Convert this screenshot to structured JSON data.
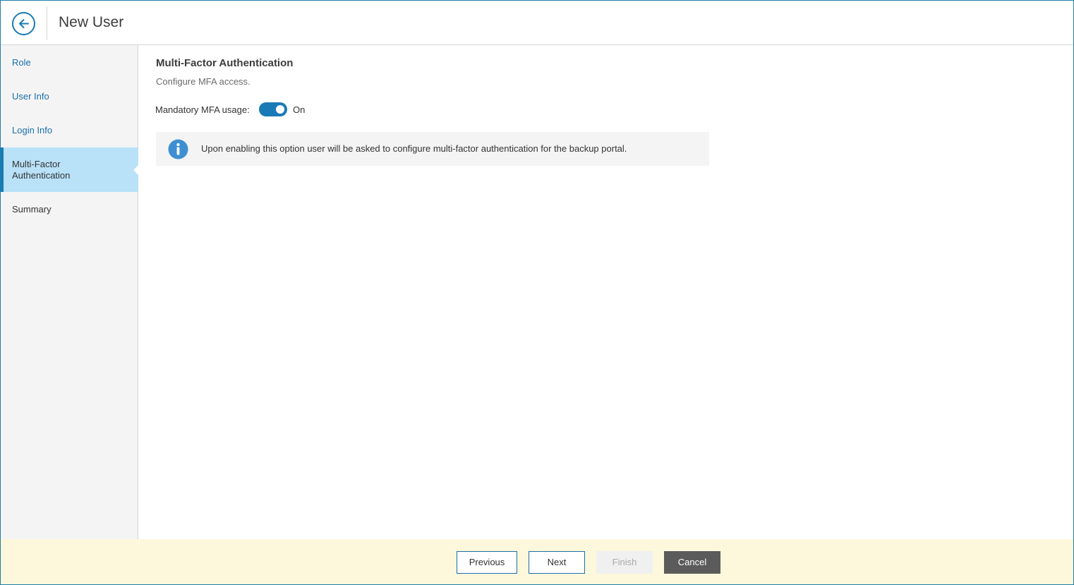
{
  "header": {
    "title": "New User",
    "back_icon": "arrow-left-icon"
  },
  "sidebar": {
    "steps": [
      {
        "label": "Role",
        "state": "link"
      },
      {
        "label": "User Info",
        "state": "link"
      },
      {
        "label": "Login Info",
        "state": "link"
      },
      {
        "label": "Multi-Factor Authentication",
        "state": "active"
      },
      {
        "label": "Summary",
        "state": "pending"
      }
    ]
  },
  "main": {
    "title": "Multi-Factor Authentication",
    "subtitle": "Configure MFA access.",
    "mfa_toggle": {
      "label": "Mandatory MFA usage:",
      "state_label": "On",
      "enabled": true
    },
    "info": {
      "icon": "info-icon",
      "text": "Upon enabling this option user will be asked to configure multi-factor authentication for the backup portal."
    }
  },
  "footer": {
    "previous_label": "Previous",
    "next_label": "Next",
    "finish_label": "Finish",
    "cancel_label": "Cancel"
  },
  "colors": {
    "accent": "#1a7ab5",
    "active_step_bg": "#b9e1f8",
    "footer_bg": "#fdf8dc",
    "cancel_bg": "#5b5b5b"
  }
}
